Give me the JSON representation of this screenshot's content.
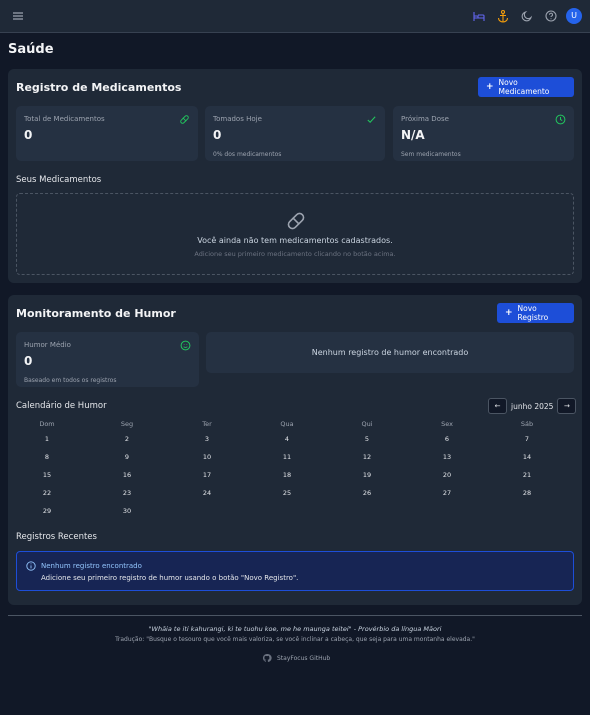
{
  "header": {
    "menu_icon": "hamburger-icon",
    "icons": [
      "bed-icon",
      "anchor-icon",
      "moon-icon",
      "help-icon"
    ],
    "avatar_initial": "U"
  },
  "page": {
    "title": "Saúde"
  },
  "medications": {
    "title": "Registro de Medicamentos",
    "new_button": "Novo Medicamento",
    "stats": [
      {
        "label": "Total de Medicamentos",
        "value": "0",
        "sub": "",
        "icon": "pill-icon"
      },
      {
        "label": "Tomados Hoje",
        "value": "0",
        "sub": "0% dos medicamentos",
        "icon": "check-icon"
      },
      {
        "label": "Próxima Dose",
        "value": "N/A",
        "sub": "Sem medicamentos",
        "icon": "clock-icon"
      }
    ],
    "list_title": "Seus Medicamentos",
    "empty_title": "Você ainda não tem medicamentos cadastrados.",
    "empty_hint": "Adicione seu primeiro medicamento clicando no botão acima."
  },
  "mood": {
    "title": "Monitoramento de Humor",
    "new_button": "Novo Registro",
    "avg_label": "Humor Médio",
    "avg_value": "0",
    "avg_sub": "Baseado em todos os registros",
    "no_records": "Nenhum registro de humor encontrado",
    "calendar_title": "Calendário de Humor",
    "month": "junho 2025",
    "prev": "←",
    "next": "→",
    "weekdays": [
      "Dom",
      "Seg",
      "Ter",
      "Qua",
      "Qui",
      "Sex",
      "Sáb"
    ],
    "first_weekday": 0,
    "days_in_month": 30,
    "recent_title": "Registros Recentes",
    "recent_alert_title": "Nenhum registro encontrado",
    "recent_alert_desc": "Adicione seu primeiro registro de humor usando o botão \"Novo Registro\"."
  },
  "footer": {
    "quote": "\"Whāia te iti kahurangi, ki te tuohu koe, me he maunga teitei\" - Provérbio da língua Māori",
    "translation": "Tradução: \"Busque o tesouro que você mais valoriza, se você inclinar a cabeça, que seja para uma montanha elevada.\"",
    "github": "StayFocus GitHub"
  },
  "colors": {
    "accent": "#1d4ed8",
    "success": "#22c55e",
    "background": "#111827",
    "card": "#1f2937"
  }
}
